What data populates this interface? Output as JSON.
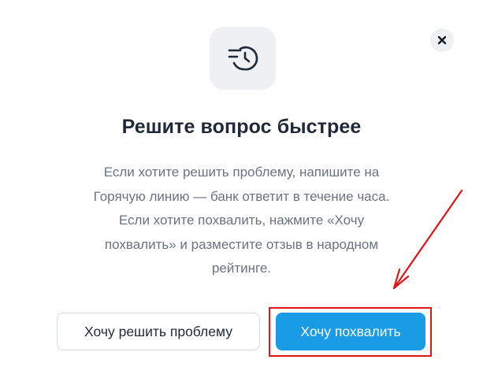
{
  "dialog": {
    "close_label": "×",
    "icon": "clock-history-icon",
    "title": "Решите вопрос быстрее",
    "body_lines": [
      "Если хотите решить проблему, напишите на",
      "Горячую линию — банк ответит в течение часа.",
      "Если хотите похвалить, нажмите «Хочу",
      "похвалить» и разместите отзыв в народном",
      "рейтинге."
    ],
    "secondary_button": "Хочу решить проблему",
    "primary_button": "Хочу похвалить"
  },
  "colors": {
    "primary": "#1a9be6",
    "annotation": "#e0141a",
    "tile": "#eef0f4",
    "title": "#1f2937",
    "body": "#6b7280"
  }
}
